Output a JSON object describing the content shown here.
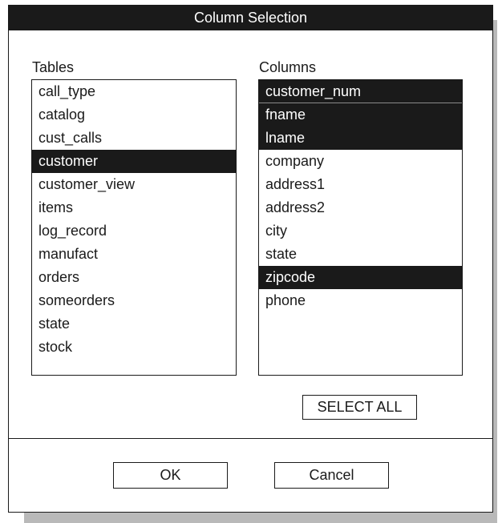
{
  "dialog": {
    "title": "Column Selection"
  },
  "tables": {
    "label": "Tables",
    "items": [
      {
        "label": "call_type",
        "selected": false
      },
      {
        "label": "catalog",
        "selected": false
      },
      {
        "label": "cust_calls",
        "selected": false
      },
      {
        "label": "customer",
        "selected": true
      },
      {
        "label": "customer_view",
        "selected": false
      },
      {
        "label": "items",
        "selected": false
      },
      {
        "label": "log_record",
        "selected": false
      },
      {
        "label": "manufact",
        "selected": false
      },
      {
        "label": "orders",
        "selected": false
      },
      {
        "label": "someorders",
        "selected": false
      },
      {
        "label": "state",
        "selected": false
      },
      {
        "label": "stock",
        "selected": false
      }
    ]
  },
  "columns": {
    "label": "Columns",
    "items": [
      {
        "label": "customer_num",
        "selected": true
      },
      {
        "label": "fname",
        "selected": true
      },
      {
        "label": "lname",
        "selected": true
      },
      {
        "label": "company",
        "selected": false
      },
      {
        "label": "address1",
        "selected": false
      },
      {
        "label": "address2",
        "selected": false
      },
      {
        "label": "city",
        "selected": false
      },
      {
        "label": "state",
        "selected": false
      },
      {
        "label": "zipcode",
        "selected": true
      },
      {
        "label": "phone",
        "selected": false
      }
    ]
  },
  "buttons": {
    "select_all": "SELECT ALL",
    "ok": "OK",
    "cancel": "Cancel"
  },
  "colors": {
    "selection_background": "#1a1a1a",
    "selection_text": "#ffffff",
    "drop_shadow": "#b9b9b9"
  }
}
